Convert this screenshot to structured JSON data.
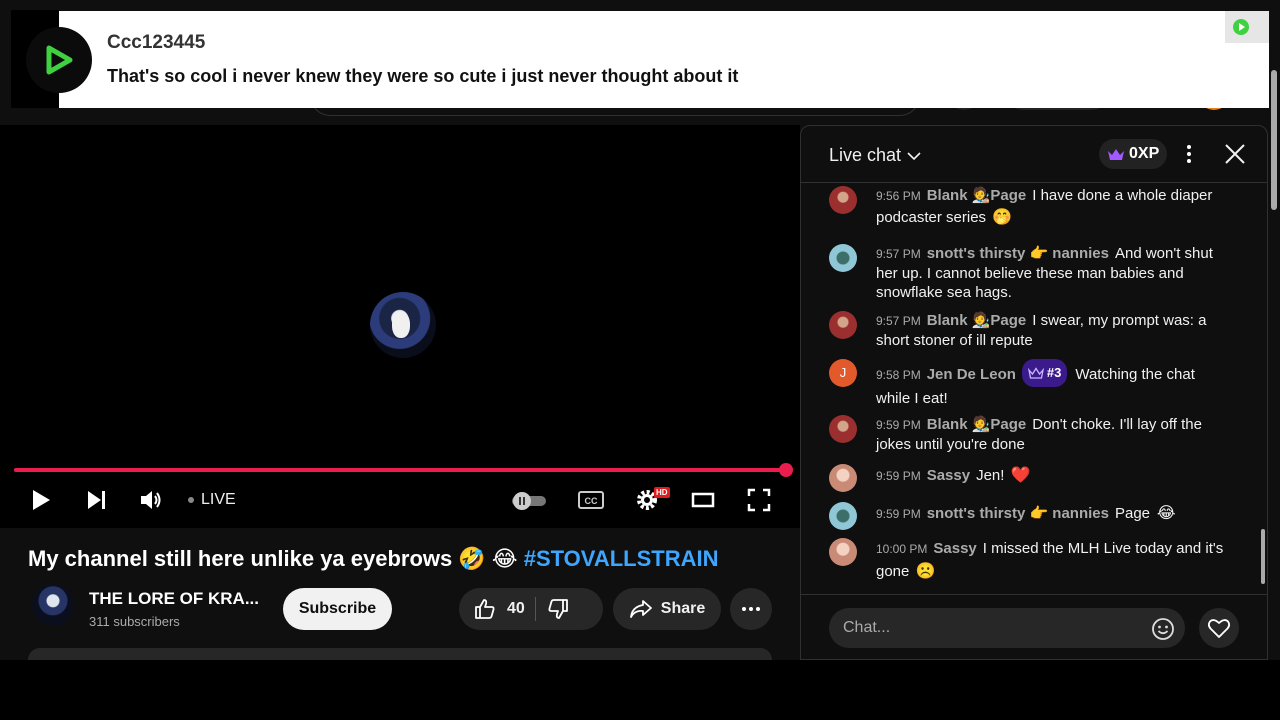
{
  "notification": {
    "username": "Ccc123445",
    "message": "That's so cool i never knew they were so cute i just never thought about it"
  },
  "player": {
    "live_label": "LIVE",
    "hd_badge": "HD",
    "progress": 1.0,
    "accent_color": "#e91e4f"
  },
  "video": {
    "title_text": "My channel still here unlike ya eyebrows 🤣 😂 ",
    "hashtag": "#STOVALLSTRAIN",
    "channel_name": "THE LORE OF KRA...",
    "subscribers": "311 subscribers",
    "subscribe_label": "Subscribe",
    "like_count": "40",
    "share_label": "Share"
  },
  "chat": {
    "title": "Live chat",
    "xp": "0XP",
    "input_placeholder": "Chat...",
    "messages": [
      {
        "time": "9:56 PM",
        "author": "Blank 🧑‍🎨Page",
        "text": "I have done a whole diaper podcaster series",
        "emoji": "🤭"
      },
      {
        "time": "9:57 PM",
        "author": "snott's thirsty 👉 nannies",
        "text": "And won't shut her up. I cannot believe these man babies and snowflake sea hags.",
        "emoji": ""
      },
      {
        "time": "9:57 PM",
        "author": "Blank 🧑‍🎨Page",
        "text": "I swear, my prompt was: a short stoner of ill repute",
        "emoji": ""
      },
      {
        "time": "9:58 PM",
        "author": "Jen De Leon",
        "badge": "#3",
        "text": "Watching the chat while I eat!",
        "emoji": "",
        "avatar_letter": "J"
      },
      {
        "time": "9:59 PM",
        "author": "Blank 🧑‍🎨Page",
        "text": "Don't choke. I'll lay off the jokes until you're done",
        "emoji": ""
      },
      {
        "time": "9:59 PM",
        "author": "Sassy",
        "text": "Jen!",
        "emoji": "❤️"
      },
      {
        "time": "9:59 PM",
        "author": "snott's thirsty 👉 nannies",
        "text": "Page",
        "emoji": "😂"
      },
      {
        "time": "10:00 PM",
        "author": "Sassy",
        "text": "I missed the MLH Live today and it's gone",
        "emoji": "☹️"
      }
    ]
  }
}
